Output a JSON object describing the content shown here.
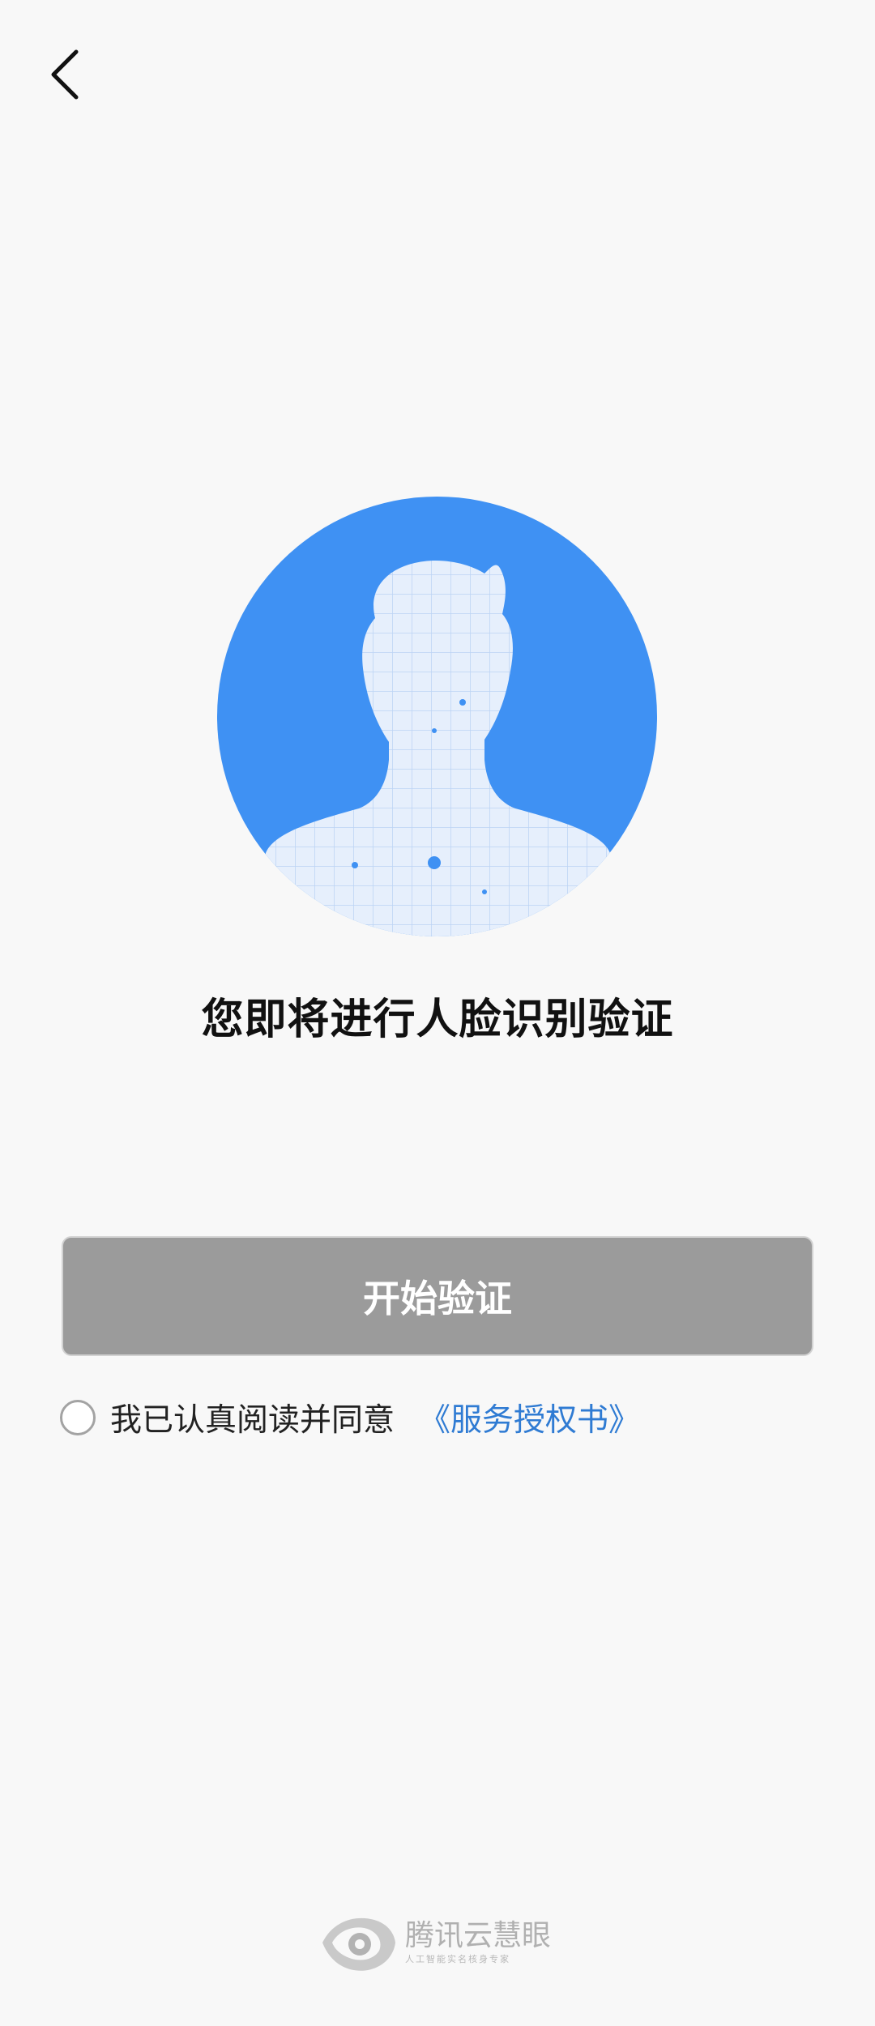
{
  "nav": {
    "back_icon": "chevron-left-icon"
  },
  "hero": {
    "icon": "face-scan-avatar-icon",
    "accent_color": "#3f91f3",
    "grid_color": "#dde9fb"
  },
  "title": "您即将进行人脸识别验证",
  "start_button": {
    "label": "开始验证",
    "state": "disabled",
    "bg_color": "#9b9b9b"
  },
  "agreement": {
    "checked": false,
    "text": "我已认真阅读并同意",
    "link_text": "《服务授权书》",
    "link_color": "#2f7bd3"
  },
  "footer": {
    "brand": "腾讯云慧眼",
    "slogan": "人工智能实名核身专家",
    "logo_icon": "eye-logo-icon"
  }
}
